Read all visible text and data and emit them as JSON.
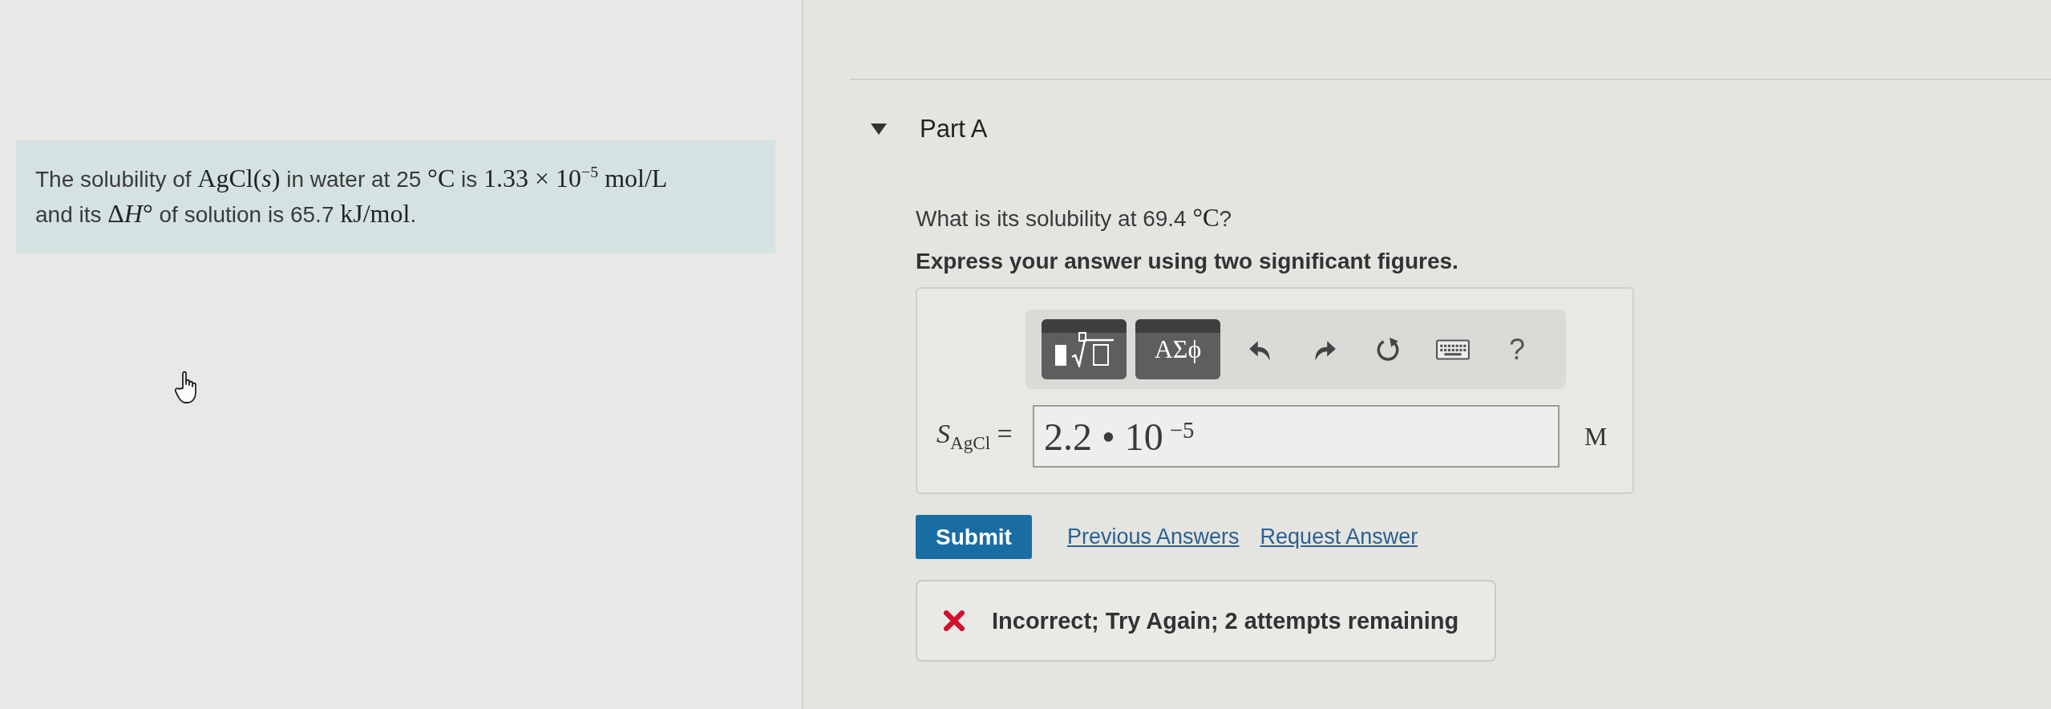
{
  "problem": {
    "segments": [
      {
        "kind": "text",
        "text": "The solubility of "
      },
      {
        "kind": "math",
        "text": "AgCl(*s*)"
      },
      {
        "kind": "text",
        "text": " in water at 25 "
      },
      {
        "kind": "math",
        "text": "°C"
      },
      {
        "kind": "text",
        "text": " is "
      },
      {
        "kind": "math",
        "text": "1.33 × 10$^{−5}$ mol/L"
      },
      {
        "kind": "text",
        "text": " and its "
      },
      {
        "kind": "math",
        "text": "Δ"
      },
      {
        "kind": "math",
        "text": "*H*°"
      },
      {
        "kind": "text",
        "text": " of solution is 65.7 "
      },
      {
        "kind": "math",
        "text": "kJ/mol"
      },
      {
        "kind": "text",
        "text": "."
      }
    ]
  },
  "part": {
    "title": "Part A",
    "expanded": true,
    "question": {
      "segments": [
        {
          "kind": "text",
          "text": "What is its solubility at 69.4 "
        },
        {
          "kind": "math",
          "text": "°C"
        },
        {
          "kind": "text",
          "text": "?"
        }
      ]
    },
    "instruction": "Express your answer using two significant figures.",
    "answer": {
      "toolbar": [
        {
          "kind": "templates"
        },
        {
          "kind": "symbols",
          "label": "ΑΣϕ"
        },
        {
          "kind": "undo"
        },
        {
          "kind": "redo"
        },
        {
          "kind": "reset"
        },
        {
          "kind": "keyboard"
        },
        {
          "kind": "help",
          "label": "?"
        }
      ],
      "label": "*S*$_{AgCl}$ =",
      "value": "2.2 • 10$^{−5}$",
      "unit": "M"
    },
    "submit": "Submit",
    "links": [
      "Previous Answers",
      "Request Answer"
    ],
    "feedback": {
      "kind": "incorrect",
      "message": "Incorrect; Try Again; 2 attempts remaining"
    }
  }
}
